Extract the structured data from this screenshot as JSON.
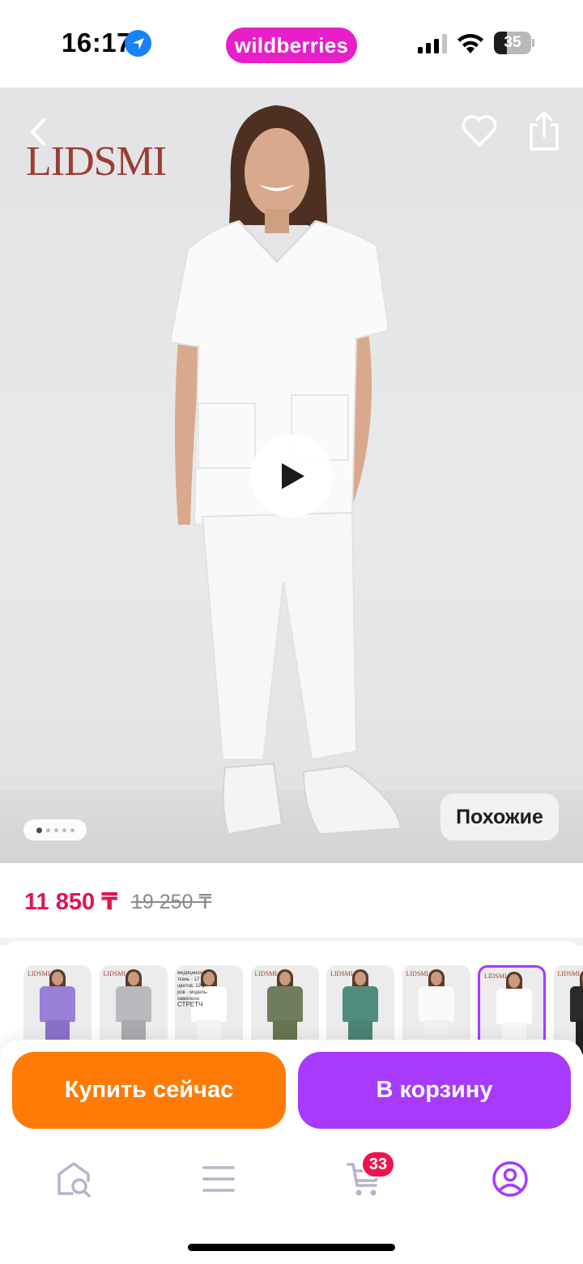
{
  "status_bar": {
    "time": "16:17",
    "app_label": "wildberries",
    "battery_percent": 35,
    "battery_level": 0.35
  },
  "product": {
    "brand_logo": "LIDSMI",
    "similar_label": "Похожие",
    "gallery": {
      "total_slides": 5,
      "active_slide": 1
    },
    "price_current": "11 850 ₸",
    "price_old": "19 250 ₸"
  },
  "variants": [
    {
      "name": "lavender",
      "top_color": "#9a7fd8",
      "pants_color": "#8b70c8",
      "selected": false
    },
    {
      "name": "gray",
      "top_color": "#b9babd",
      "pants_color": "#a9aaae",
      "selected": false
    },
    {
      "name": "white-infographic",
      "top_color": "#ffffff",
      "pants_color": "#f4f4f4",
      "selected": false,
      "text": "медицинская ткань · 17 цветов, 12 р-ров · модель-хамелеон",
      "stretch": "СТРЕТЧ"
    },
    {
      "name": "olive",
      "top_color": "#6f7d5e",
      "pants_color": "#66744f",
      "selected": false
    },
    {
      "name": "teal",
      "top_color": "#4f8c7e",
      "pants_color": "#4a8475",
      "selected": false
    },
    {
      "name": "white-robe",
      "top_color": "#fafafa",
      "pants_color": "#f0f0f0",
      "selected": false
    },
    {
      "name": "white",
      "top_color": "#ffffff",
      "pants_color": "#f6f6f6",
      "selected": true
    },
    {
      "name": "black",
      "top_color": "#2a2a2c",
      "pants_color": "#222224",
      "selected": false
    }
  ],
  "actions": {
    "buy_now_label": "Купить сейчас",
    "add_to_cart_label": "В корзину"
  },
  "tab_bar": {
    "items": [
      {
        "name": "home",
        "icon": "home-search-icon"
      },
      {
        "name": "catalog",
        "icon": "menu-icon"
      },
      {
        "name": "cart",
        "icon": "cart-icon"
      },
      {
        "name": "profile",
        "icon": "profile-icon"
      }
    ],
    "cart_badge": "33"
  },
  "colors": {
    "brand_pink": "#e81ec8",
    "accent_purple": "#a73afd",
    "buy_orange": "#ff7b06",
    "price_red": "#e5124f",
    "badge_red": "#f0124e"
  }
}
